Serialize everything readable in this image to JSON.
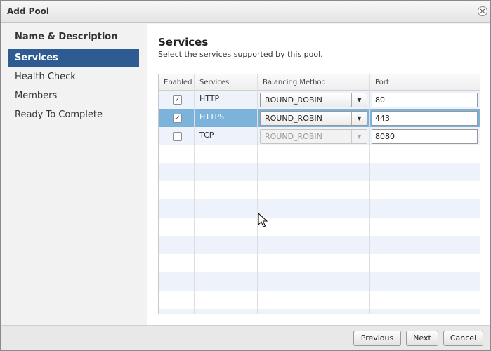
{
  "dialog": {
    "title": "Add Pool",
    "close_symbol": "×"
  },
  "sidebar": {
    "items": [
      {
        "label": "Name & Description"
      },
      {
        "label": "Services"
      },
      {
        "label": "Health Check"
      },
      {
        "label": "Members"
      },
      {
        "label": "Ready To Complete"
      }
    ],
    "active_index": 1
  },
  "main": {
    "heading": "Services",
    "subheading": "Select the services supported by this pool.",
    "columns": [
      "Enabled",
      "Services",
      "Balancing Method",
      "Port"
    ],
    "rows": [
      {
        "enabled": true,
        "service": "HTTP",
        "method": "ROUND_ROBIN",
        "port": "80",
        "selected": false,
        "method_disabled": false
      },
      {
        "enabled": true,
        "service": "HTTPS",
        "method": "ROUND_ROBIN",
        "port": "443",
        "selected": true,
        "method_disabled": false
      },
      {
        "enabled": false,
        "service": "TCP",
        "method": "ROUND_ROBIN",
        "port": "8080",
        "selected": false,
        "method_disabled": true
      }
    ]
  },
  "footer": {
    "previous_label": "Previous",
    "next_label": "Next",
    "cancel_label": "Cancel"
  },
  "colors": {
    "active_nav": "#2d5b92",
    "selected_row": "#7cb3db",
    "alt_row": "#eef3fb"
  },
  "icons": {
    "checkmark": "✓",
    "dropdown_arrow": "▼"
  }
}
